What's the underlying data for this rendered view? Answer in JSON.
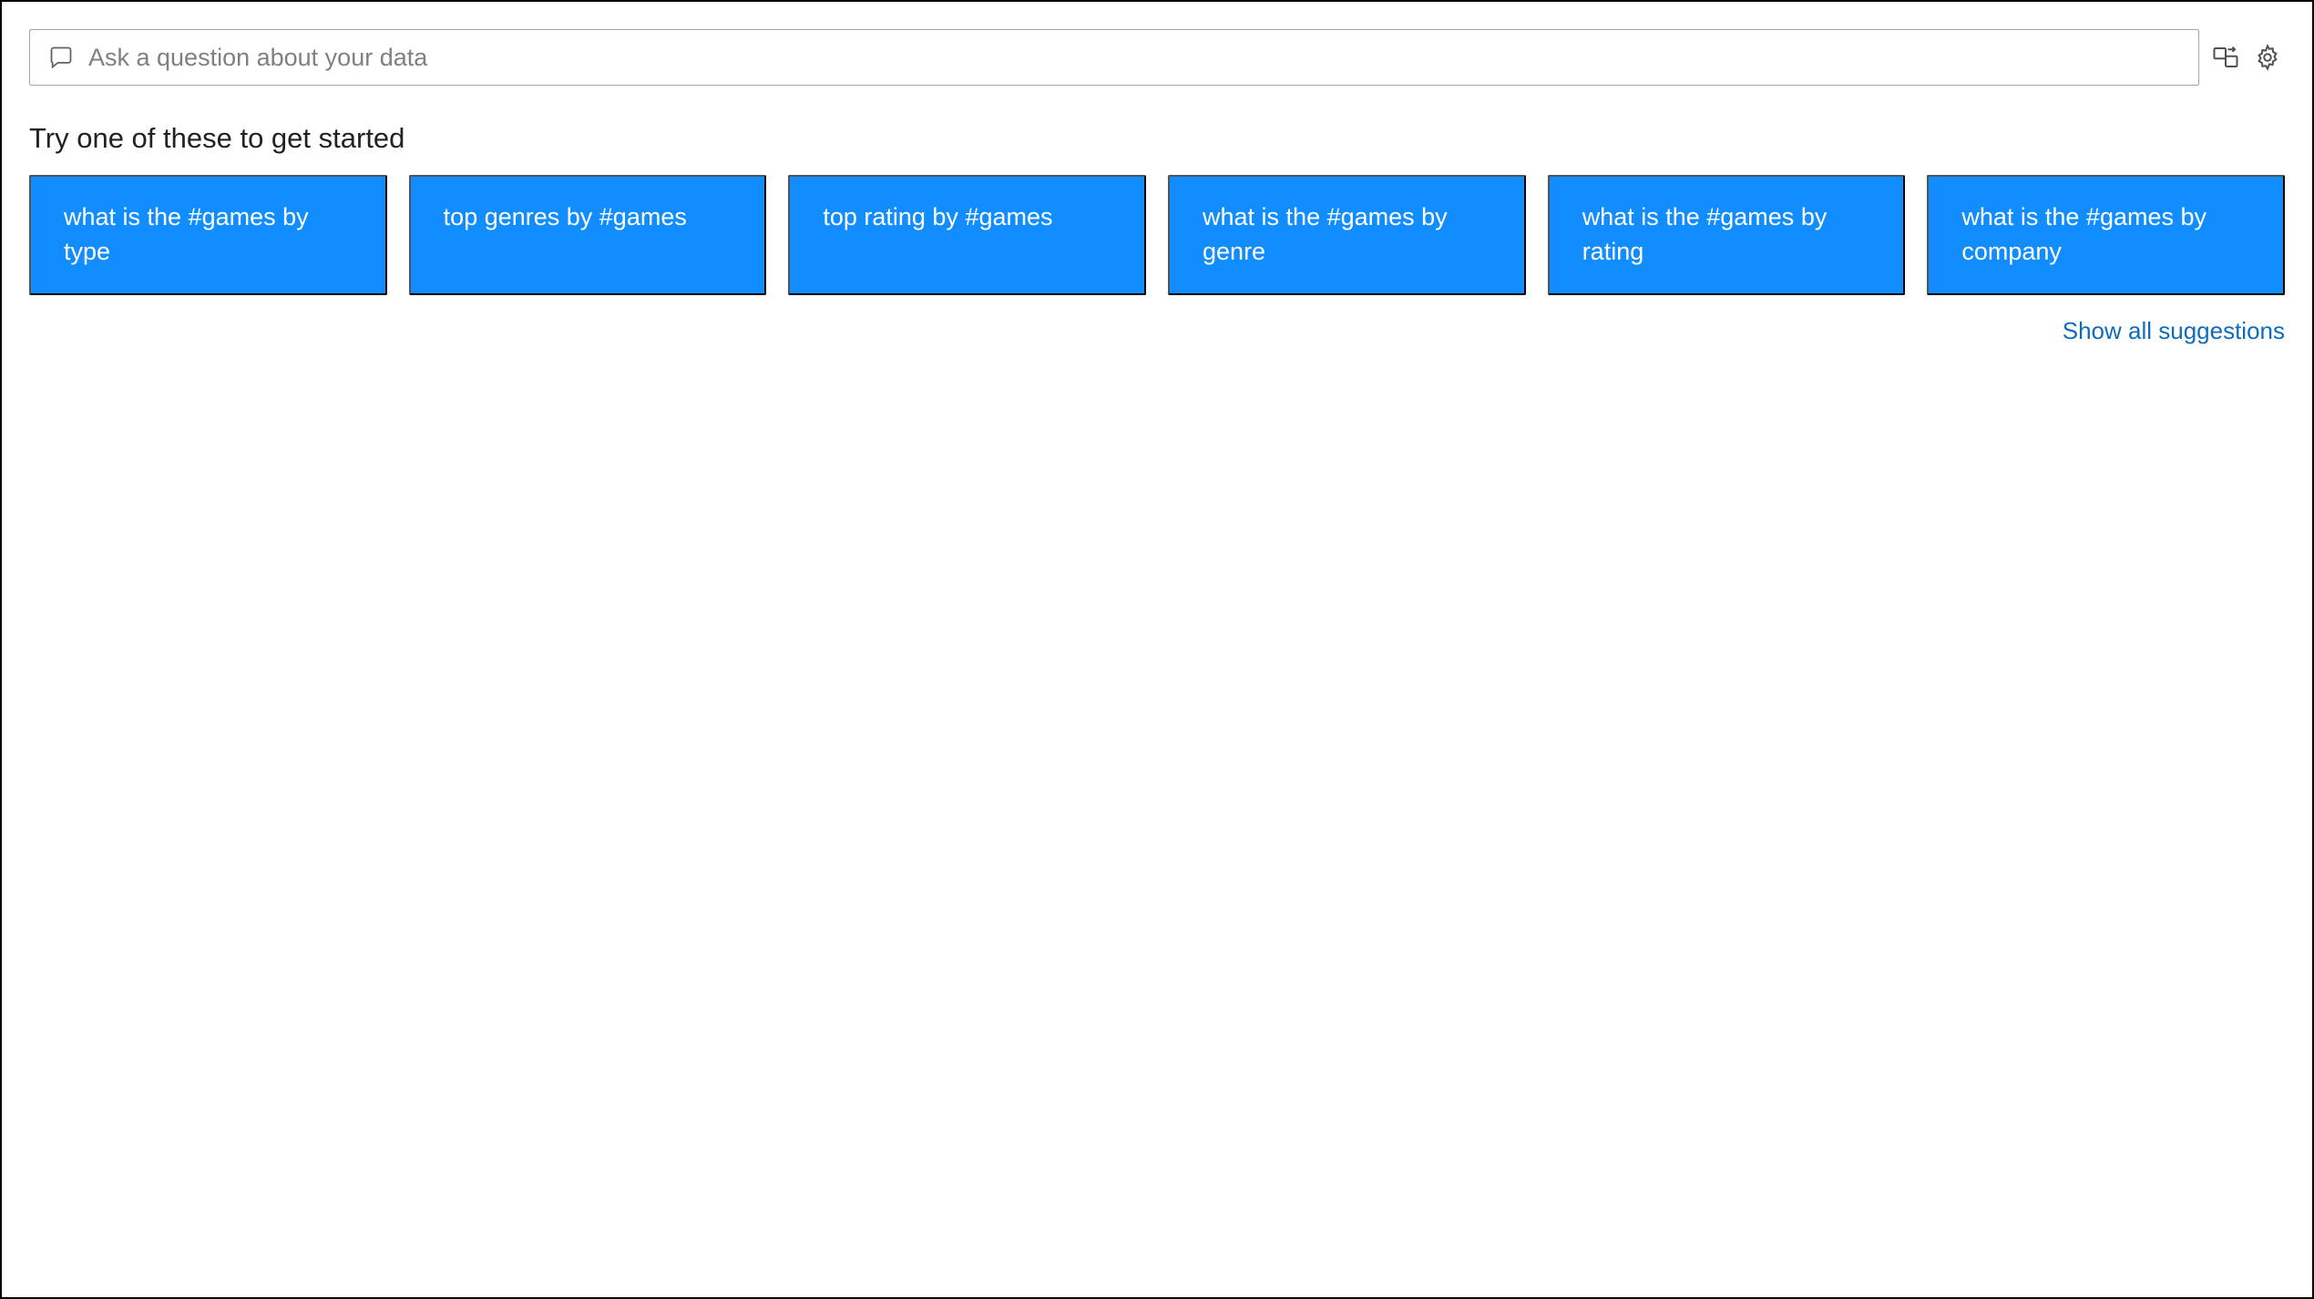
{
  "search": {
    "placeholder": "Ask a question about your data",
    "value": ""
  },
  "subtitle": "Try one of these to get started",
  "suggestions": [
    {
      "label": "what is the #games by type"
    },
    {
      "label": "top genres by #games"
    },
    {
      "label": "top rating by #games"
    },
    {
      "label": "what is the #games by genre"
    },
    {
      "label": "what is the #games by rating"
    },
    {
      "label": "what is the #games by company"
    }
  ],
  "show_all_label": "Show all suggestions",
  "colors": {
    "accent": "#118dff",
    "link": "#0f6cbd"
  }
}
